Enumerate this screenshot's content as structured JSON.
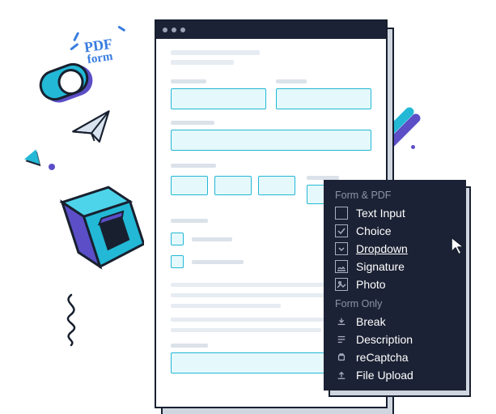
{
  "decor": {
    "pdf_label_line1": "PDF",
    "pdf_label_line2": "form"
  },
  "menu": {
    "group1_label": "Form & PDF",
    "group1": [
      {
        "label": "Text Input",
        "icon": "text-input-icon"
      },
      {
        "label": "Choice",
        "icon": "choice-icon"
      },
      {
        "label": "Dropdown",
        "icon": "dropdown-icon",
        "hover": true
      },
      {
        "label": "Signature",
        "icon": "signature-icon"
      },
      {
        "label": "Photo",
        "icon": "photo-icon"
      }
    ],
    "group2_label": "Form Only",
    "group2": [
      {
        "label": "Break",
        "icon": "break-icon"
      },
      {
        "label": "Description",
        "icon": "description-icon"
      },
      {
        "label": "reCaptcha",
        "icon": "recaptcha-icon"
      },
      {
        "label": "File Upload",
        "icon": "file-upload-icon"
      }
    ]
  }
}
